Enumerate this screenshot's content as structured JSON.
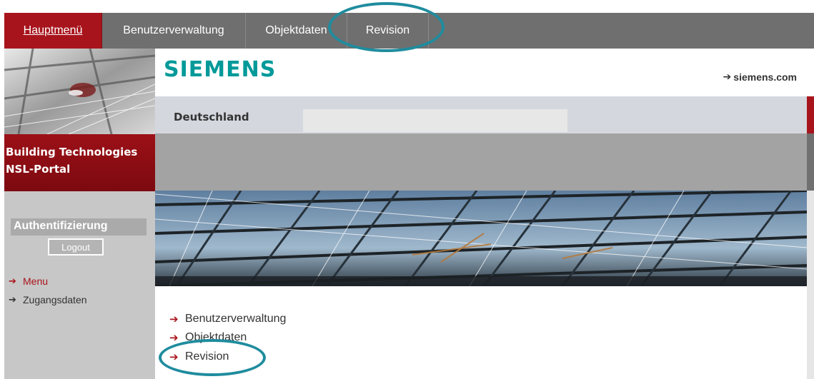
{
  "top_nav": {
    "tabs": [
      {
        "label": "Hauptmenü",
        "active": true
      },
      {
        "label": "Benutzerverwaltung",
        "active": false
      },
      {
        "label": "Objektdaten",
        "active": false
      },
      {
        "label": "Revision",
        "active": false
      }
    ]
  },
  "sidebar": {
    "brand_line1": "Building Technologies",
    "brand_line2": "NSL-Portal",
    "auth_title": "Authentifizierung",
    "logout_label": "Logout",
    "nav_items": [
      {
        "label": "Menu",
        "active": true
      },
      {
        "label": "Zugangsdaten",
        "active": false
      }
    ]
  },
  "header": {
    "logo_text": "SIEMENS",
    "site_link": "siemens.com",
    "country": "Deutschland"
  },
  "main": {
    "links": [
      "Benutzerverwaltung",
      "Objektdaten",
      "Revision"
    ]
  },
  "colors": {
    "accent_red": "#a8141c",
    "siemens_teal": "#009999",
    "annotation": "#1f8c9e"
  }
}
